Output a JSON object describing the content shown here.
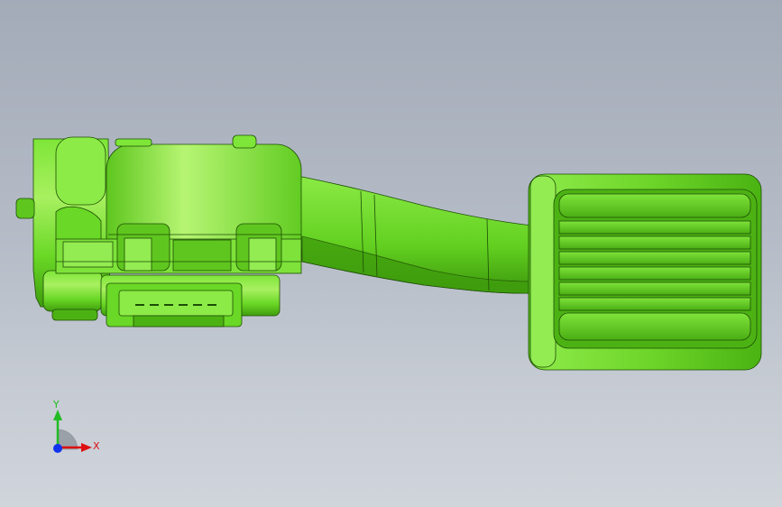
{
  "viewport": {
    "background_top": "#a3abb8",
    "background_bottom": "#d0d4db",
    "model": {
      "body_color": "#66dd22",
      "highlight_color": "#a8f060",
      "shadow_color": "#2f8a08",
      "edge_color": "#1d4d05"
    }
  },
  "triad": {
    "x_label": "X",
    "y_label": "Y",
    "x_color": "#dd1111",
    "y_color": "#22bb22",
    "z_color": "#1133ee",
    "icon": "coordinate-triad-icon"
  }
}
